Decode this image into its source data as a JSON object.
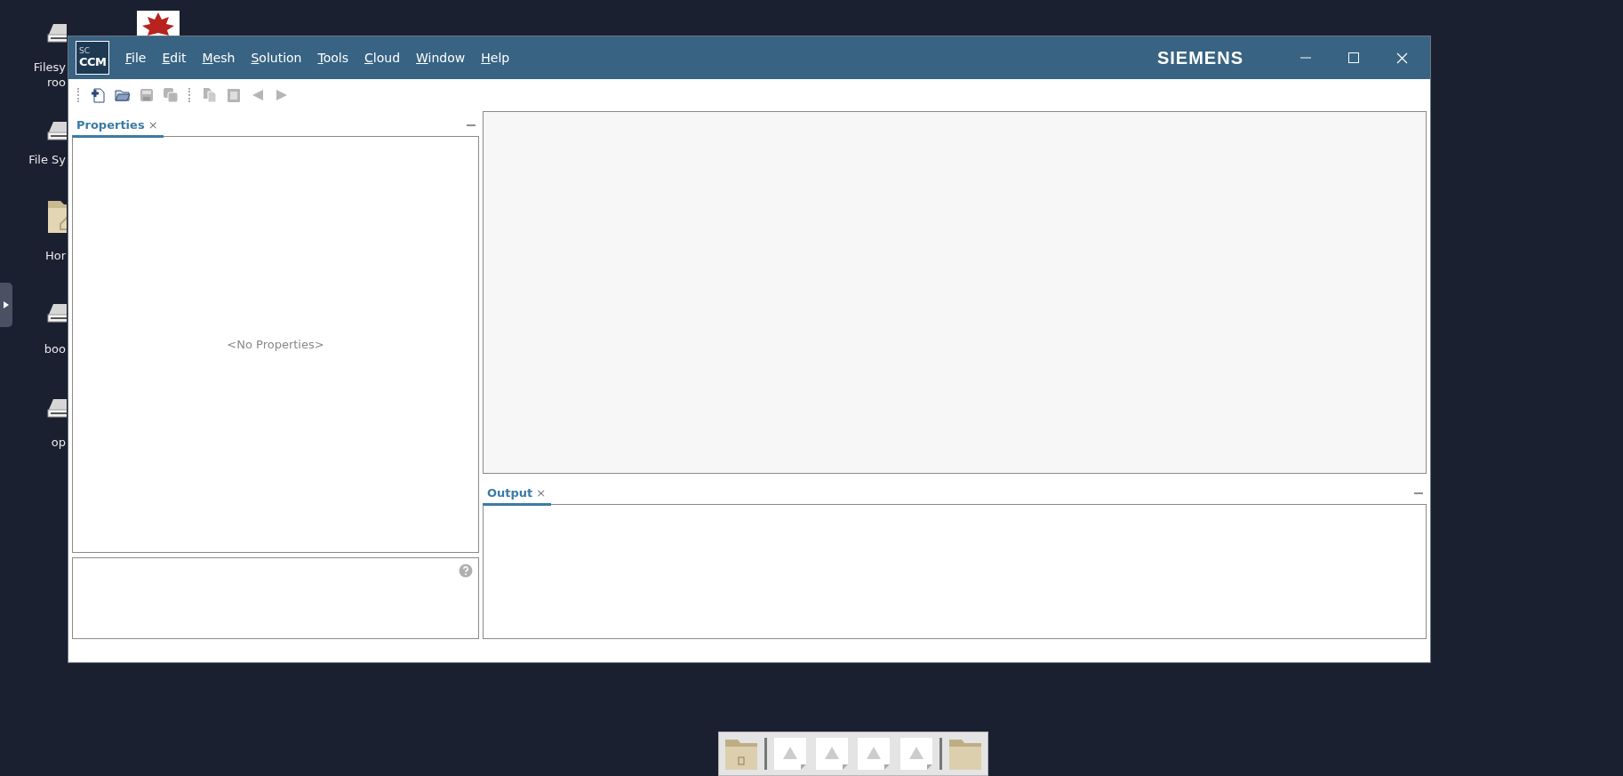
{
  "desktop": {
    "icons": [
      {
        "kind": "drive",
        "lines": [
          "Filesy",
          "roo"
        ]
      },
      {
        "kind": "drive",
        "lines": [
          "File Sy"
        ]
      },
      {
        "kind": "home",
        "lines": [
          "Hor"
        ]
      },
      {
        "kind": "drive",
        "lines": [
          "boo"
        ]
      },
      {
        "kind": "drive",
        "lines": [
          "op"
        ]
      },
      {
        "kind": "app"
      }
    ]
  },
  "window": {
    "logo": {
      "small": "SC",
      "large": "CCM"
    },
    "brand": "SIEMENS",
    "menus": [
      "File",
      "Edit",
      "Mesh",
      "Solution",
      "Tools",
      "Cloud",
      "Window",
      "Help"
    ],
    "toolbar": [
      {
        "kind": "new",
        "disabled": false
      },
      {
        "kind": "open",
        "disabled": false
      },
      {
        "kind": "save",
        "disabled": true
      },
      {
        "kind": "save-all",
        "disabled": true
      },
      {
        "kind": "separator"
      },
      {
        "kind": "copy",
        "disabled": true
      },
      {
        "kind": "paste",
        "disabled": true
      },
      {
        "kind": "back",
        "disabled": true
      },
      {
        "kind": "forward",
        "disabled": true
      }
    ]
  },
  "properties": {
    "tab": {
      "label": "Properties",
      "close": "×",
      "selected": true
    },
    "empty_text": "<No Properties>"
  },
  "output": {
    "tab": {
      "label": "Output",
      "close": "×",
      "selected": true
    }
  },
  "dock": [
    {
      "kind": "drive-folder"
    },
    {
      "kind": "separator"
    },
    {
      "kind": "warning-file"
    },
    {
      "kind": "warning-file"
    },
    {
      "kind": "warning-file"
    },
    {
      "kind": "warning-file"
    },
    {
      "kind": "separator"
    },
    {
      "kind": "folder"
    }
  ]
}
